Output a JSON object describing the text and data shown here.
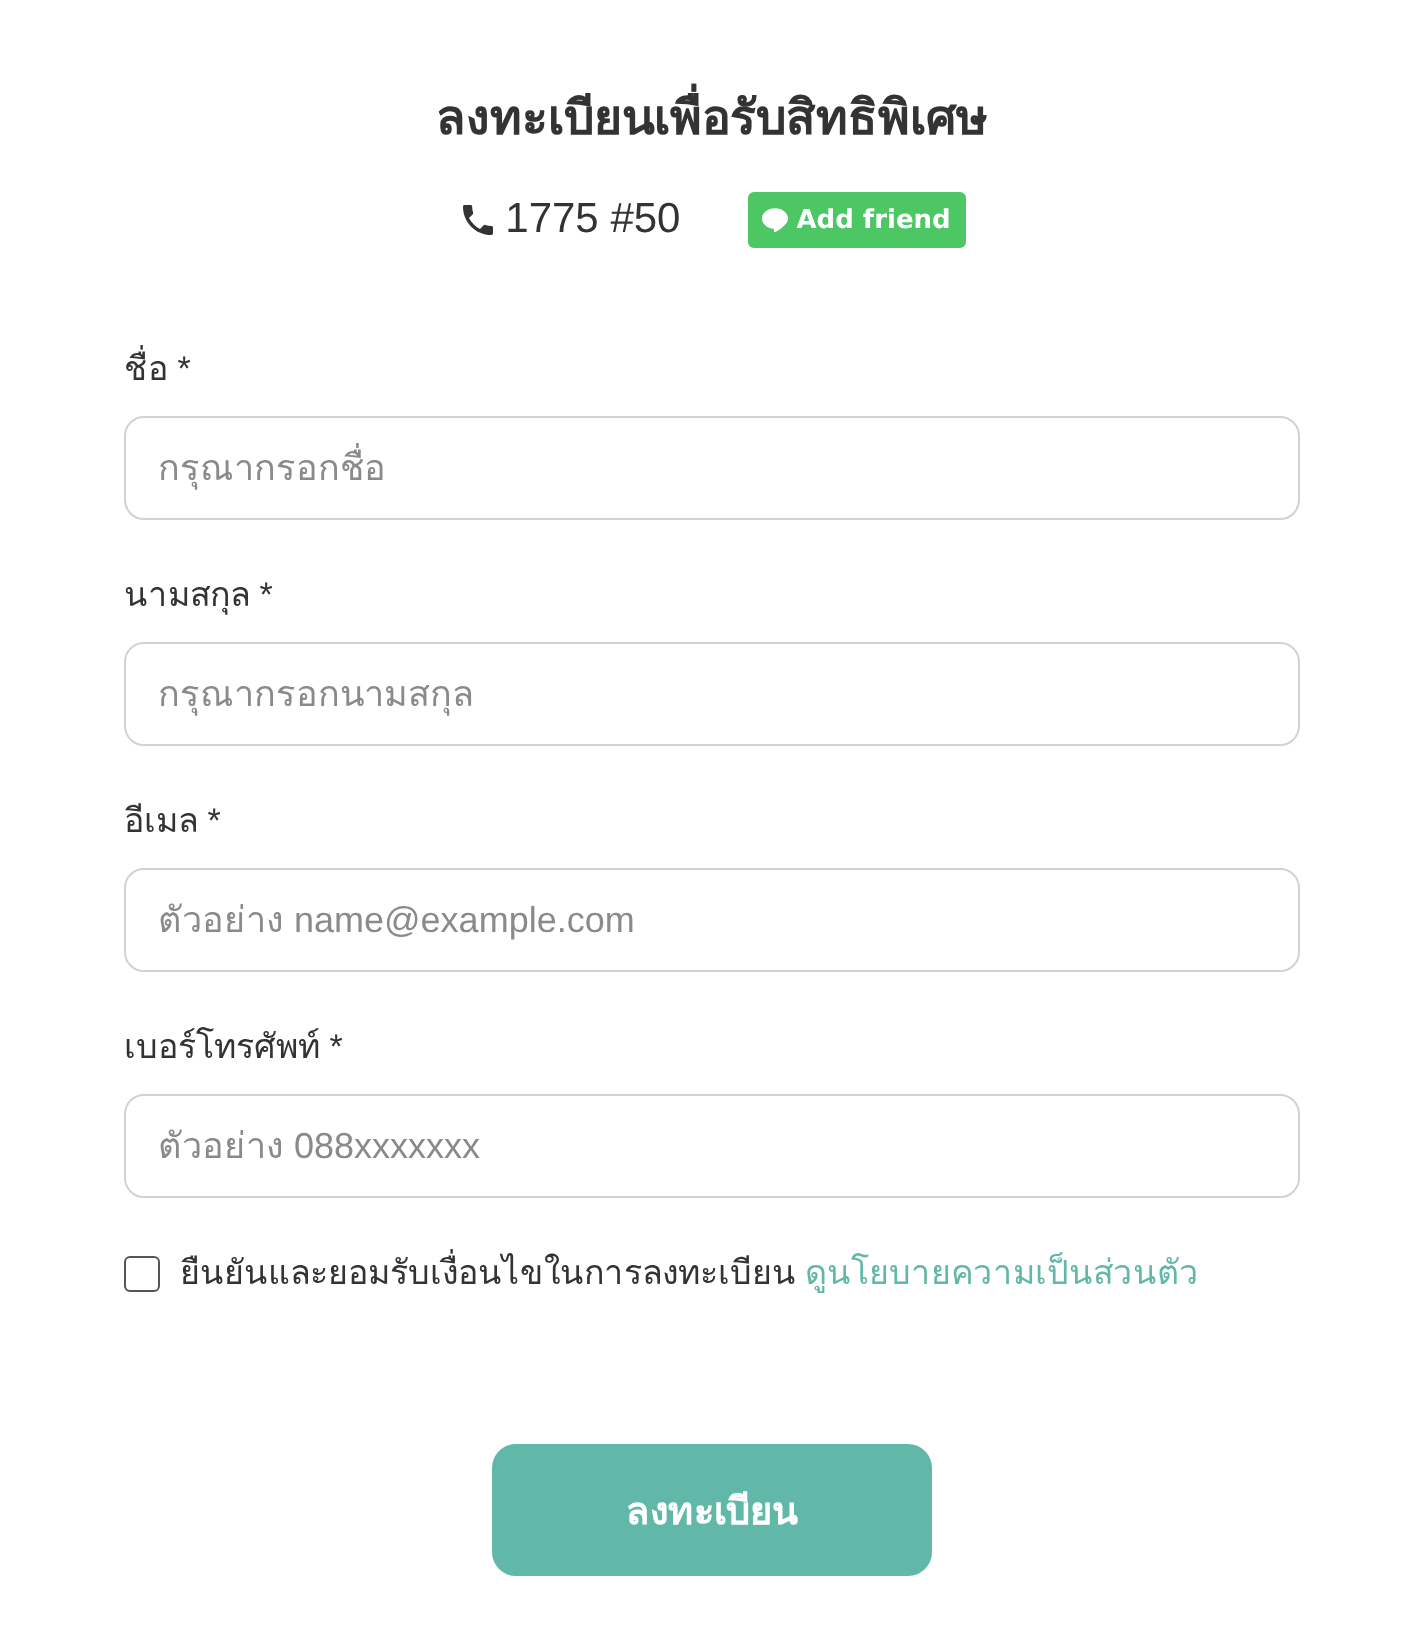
{
  "header": {
    "title": "ลงทะเบียนเพื่อรับสิทธิพิเศษ",
    "phone": "1775 #50",
    "add_friend_button": "Add friend"
  },
  "fields": [
    {
      "label": "ชื่อ *",
      "placeholder": "กรุณากรอกชื่อ"
    },
    {
      "label": "นามสกุล *",
      "placeholder": "กรุณากรอกนามสกุล"
    },
    {
      "label": "อีเมล *",
      "placeholder": "ตัวอย่าง name@example.com"
    },
    {
      "label": "เบอร์โทรศัพท์ *",
      "placeholder": "ตัวอย่าง 088xxxxxxx"
    }
  ],
  "consent": {
    "checked": false,
    "text": "ยืนยันและยอมรับเงื่อนไขในการลงทะเบียน",
    "link": "ดูนโยบายความเป็นส่วนตัว"
  },
  "submit_button": "ลงทะเบียน"
}
